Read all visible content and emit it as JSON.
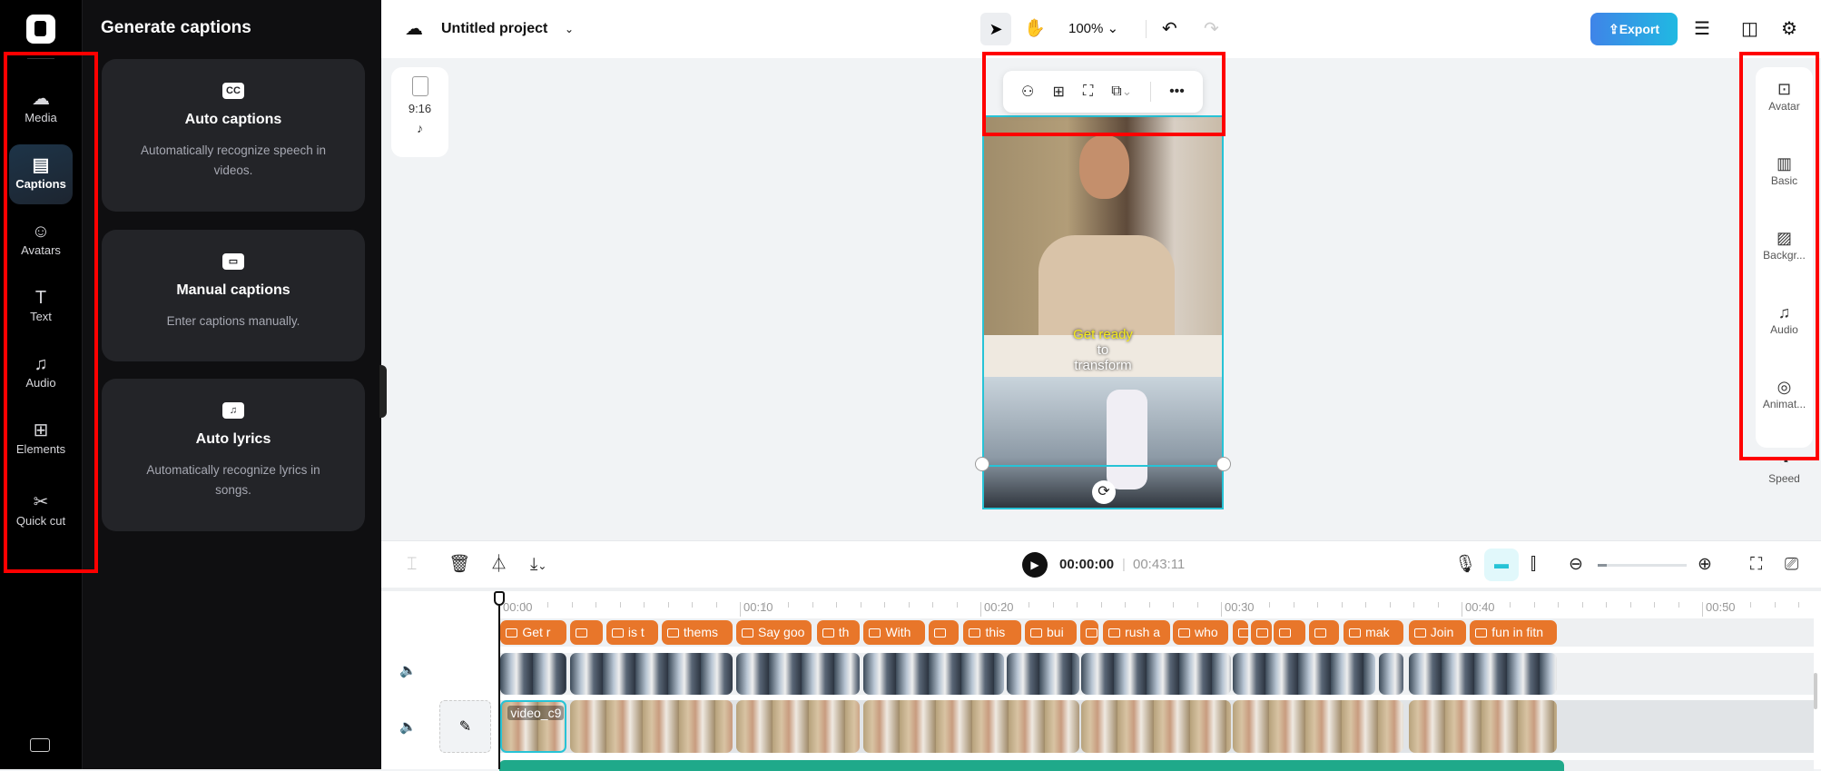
{
  "rail": {
    "items": [
      {
        "label": "Media",
        "icon": "cloud-upload-icon"
      },
      {
        "label": "Captions",
        "icon": "captions-icon",
        "active": true
      },
      {
        "label": "Avatars",
        "icon": "avatar-icon"
      },
      {
        "label": "Text",
        "icon": "text-icon"
      },
      {
        "label": "Audio",
        "icon": "music-icon"
      },
      {
        "label": "Elements",
        "icon": "elements-icon"
      },
      {
        "label": "Quick cut",
        "icon": "quick-cut-icon"
      }
    ]
  },
  "panel": {
    "title": "Generate captions",
    "cards": [
      {
        "title": "Auto captions",
        "desc": "Automatically recognize speech in videos.",
        "icon": "CC"
      },
      {
        "title": "Manual captions",
        "desc": "Enter captions manually.",
        "icon": "▭"
      },
      {
        "title": "Auto lyrics",
        "desc": "Automatically recognize lyrics in songs.",
        "icon": "♫"
      }
    ]
  },
  "topbar": {
    "project": "Untitled project",
    "zoom": "100%",
    "export": "Export"
  },
  "ratio": {
    "label": "9:16"
  },
  "preview": {
    "caption_highlight": "Get ready",
    "caption_line2": "to",
    "caption_line3": "transform"
  },
  "rightpanel": {
    "items": [
      "Avatar",
      "Basic",
      "Backgr...",
      "Audio",
      "Animat...",
      "Speed"
    ]
  },
  "timeline": {
    "current": "00:00:00",
    "total": "00:43:11",
    "zoom_level": 0.1,
    "ruler": [
      "00:00",
      "00:10",
      "00:20",
      "00:30",
      "00:40",
      "00:50"
    ],
    "captions": [
      {
        "t": "Get r",
        "s": 0.05,
        "e": 2.8
      },
      {
        "t": "",
        "s": 2.95,
        "e": 4.3
      },
      {
        "t": "is t",
        "s": 4.45,
        "e": 6.6
      },
      {
        "t": "thems",
        "s": 6.75,
        "e": 9.7
      },
      {
        "t": "Say goo",
        "s": 9.85,
        "e": 13.0
      },
      {
        "t": "th",
        "s": 13.2,
        "e": 15.0
      },
      {
        "t": "With",
        "s": 15.15,
        "e": 17.7
      },
      {
        "t": "",
        "s": 17.85,
        "e": 19.1
      },
      {
        "t": "this",
        "s": 19.3,
        "e": 21.7
      },
      {
        "t": "bui",
        "s": 21.85,
        "e": 24.0
      },
      {
        "t": "",
        "s": 24.15,
        "e": 24.9
      },
      {
        "t": "rush a",
        "s": 25.1,
        "e": 27.9
      },
      {
        "t": "who",
        "s": 28.0,
        "e": 30.3
      },
      {
        "t": "",
        "s": 30.5,
        "e": 31.15
      },
      {
        "t": "",
        "s": 31.25,
        "e": 32.1
      },
      {
        "t": "",
        "s": 32.2,
        "e": 33.5
      },
      {
        "t": "",
        "s": 33.65,
        "e": 34.9
      },
      {
        "t": "mak",
        "s": 35.1,
        "e": 37.6
      },
      {
        "t": "Join",
        "s": 37.8,
        "e": 40.2
      },
      {
        "t": "fun in fitn",
        "s": 40.35,
        "e": 43.95
      }
    ],
    "track1": [
      {
        "s": 0.05,
        "e": 2.8
      },
      {
        "s": 2.95,
        "e": 9.7
      },
      {
        "s": 9.85,
        "e": 15.0
      },
      {
        "s": 15.15,
        "e": 21.0
      },
      {
        "s": 21.1,
        "e": 24.1
      },
      {
        "s": 24.2,
        "e": 30.4
      },
      {
        "s": 30.5,
        "e": 36.4
      },
      {
        "s": 36.55,
        "e": 37.6
      },
      {
        "s": 37.8,
        "e": 43.95
      }
    ],
    "track2": [
      {
        "s": 0.05,
        "e": 2.8,
        "label": "video_c9",
        "selected": true
      },
      {
        "s": 2.95,
        "e": 9.7
      },
      {
        "s": 9.85,
        "e": 15.0
      },
      {
        "s": 15.15,
        "e": 24.1
      },
      {
        "s": 24.2,
        "e": 30.4
      },
      {
        "s": 30.5,
        "e": 37.6
      },
      {
        "s": 37.8,
        "e": 43.95
      }
    ]
  },
  "colors": {
    "accent": "#27c3d6",
    "caption_clip": "#e8762a",
    "audio": "#1fa98a"
  }
}
